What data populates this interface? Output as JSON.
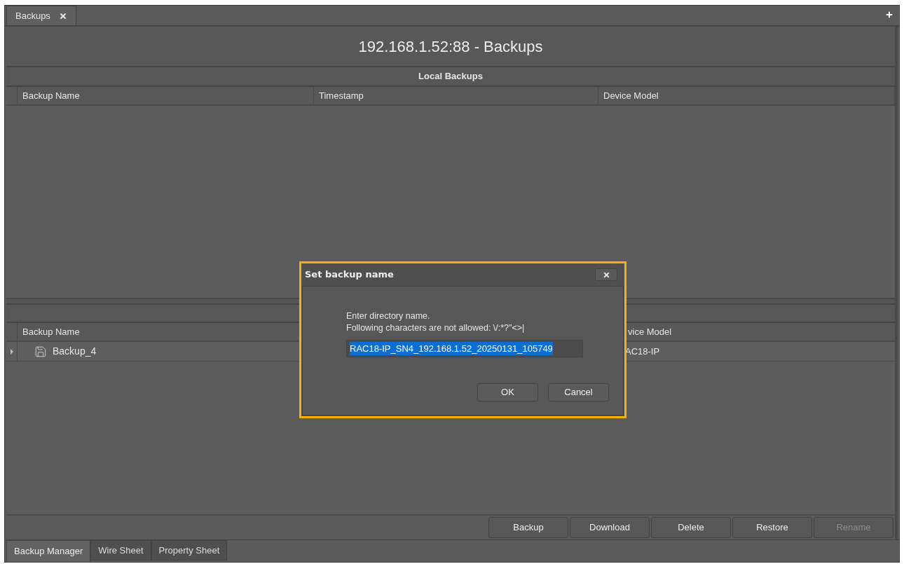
{
  "tab": {
    "label": "Backups",
    "selected": true
  },
  "title": "192.168.1.52:88 - Backups",
  "local": {
    "title": "Local Backups",
    "columns": [
      "Backup Name",
      "Timestamp",
      "Device Model"
    ]
  },
  "device": {
    "header": {
      "backup_name": "Backup Name",
      "column_3": "vice Model"
    },
    "rows": [
      {
        "backup_name": "Backup_4",
        "column_3": "AC18-IP",
        "expanded": false
      }
    ]
  },
  "actions": [
    {
      "label": "Backup",
      "disabled": false
    },
    {
      "label": "Download",
      "disabled": false
    },
    {
      "label": "Delete",
      "disabled": false
    },
    {
      "label": "Restore",
      "disabled": false
    },
    {
      "label": "Rename",
      "disabled": true
    }
  ],
  "bottom_tabs": [
    {
      "label": "Backup Manager",
      "selected": true
    },
    {
      "label": "Wire Sheet",
      "selected": false
    },
    {
      "label": "Property Sheet",
      "selected": false
    }
  ],
  "dialog": {
    "title": "Set backup name",
    "message": "Enter directory name.",
    "hint": "Following characters are not allowed: \\/:*?\"<>|",
    "value": "RAC18-IP_SN4_192.168.1.52_20250131_105749",
    "value_selected": true,
    "buttons": [
      {
        "label": "OK"
      },
      {
        "label": "Cancel"
      }
    ]
  }
}
